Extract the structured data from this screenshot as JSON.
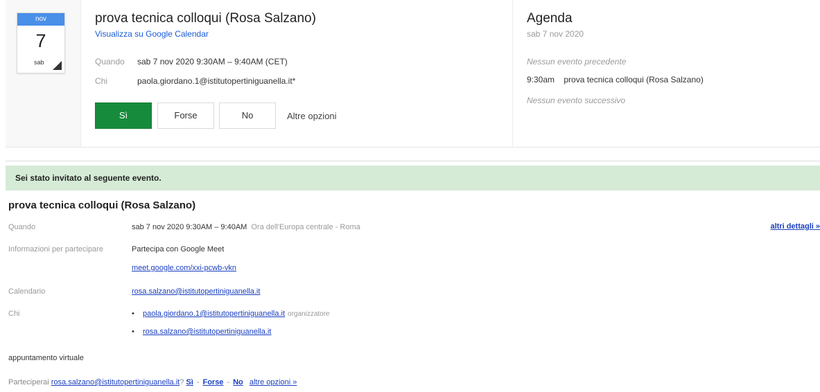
{
  "event_card": {
    "cal_month": "nov",
    "cal_day": "7",
    "cal_weekday": "sab",
    "title": "prova tecnica colloqui (Rosa Salzano)",
    "view_link": "Visualizza su Google Calendar",
    "when_label": "Quando",
    "when_value": "sab 7 nov 2020 9:30AM – 9:40AM (CET)",
    "who_label": "Chi",
    "who_value": "paola.giordano.1@istitutopertiniguanella.it*",
    "buttons": {
      "yes": "Sì",
      "maybe": "Forse",
      "no": "No",
      "more": "Altre opzioni"
    },
    "colors": {
      "yes_button": "#168b3c",
      "calendar_header": "#4a8fe8"
    }
  },
  "agenda": {
    "title": "Agenda",
    "date": "sab 7 nov 2020",
    "prev": "Nessun evento precedente",
    "event_time": "9:30am",
    "event_title": "prova tecnica colloqui (Rosa Salzano)",
    "next": "Nessun evento successivo"
  },
  "invite": {
    "banner": "Sei stato invitato al seguente evento.",
    "banner_color": "#d5ebd6",
    "title": "prova tecnica colloqui (Rosa Salzano)",
    "when_label": "Quando",
    "when_value": "sab 7 nov 2020 9:30AM – 9:40AM",
    "when_tz": "Ora dell'Europa centrale - Roma",
    "more_details": "altri dettagli »",
    "join_label": "Informazioni per partecipare",
    "join_text": "Partecipa con Google Meet",
    "meet_link": "meet.google.com/xxi-pcwb-vkn",
    "calendar_label": "Calendario",
    "calendar_value": "rosa.salzano@istitutopertiniguanella.it",
    "who_label": "Chi",
    "guests": [
      {
        "email": "paola.giordano.1@istitutopertiniguanella.it",
        "role": "organizzatore"
      },
      {
        "email": "rosa.salzano@istitutopertiniguanella.it",
        "role": ""
      }
    ],
    "description": "appuntamento virtuale",
    "rsvp_prefix": "Parteciperai",
    "rsvp_email": "rosa.salzano@istitutopertiniguanella.it",
    "rsvp_q": "?",
    "rsvp_yes": "Sì",
    "rsvp_maybe": "Forse",
    "rsvp_no": "No",
    "rsvp_more": "altre opzioni »"
  }
}
